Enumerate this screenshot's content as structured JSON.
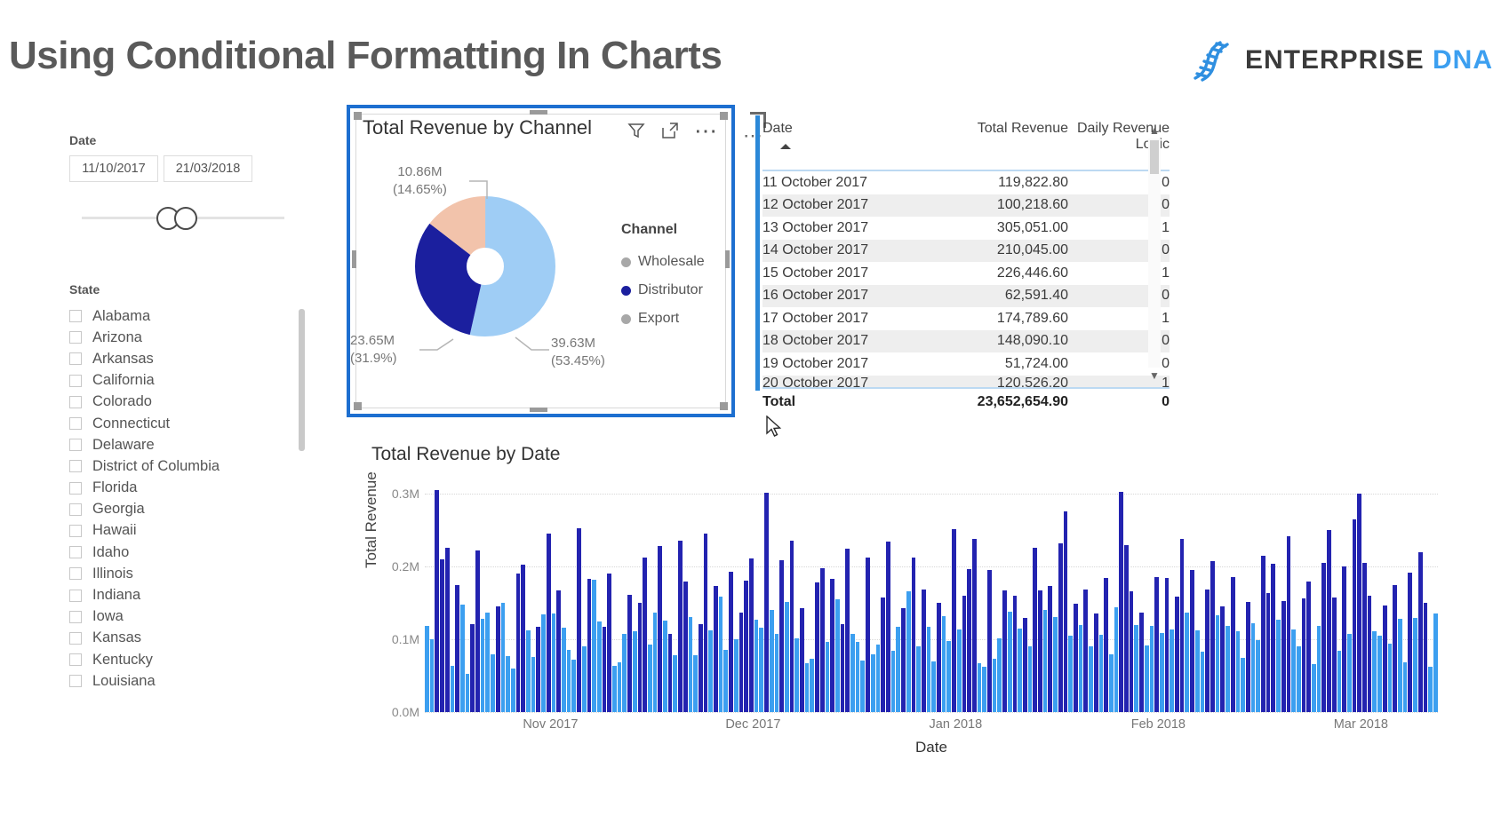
{
  "header": {
    "title": "Using Conditional Formatting In Charts",
    "brand_word1": "ENTERPRISE",
    "brand_word2": "DNA",
    "brand_icon": "dna-helix-icon"
  },
  "date_slicer": {
    "label": "Date",
    "start_value": "11/10/2017",
    "end_value": "21/03/2018"
  },
  "state_slicer": {
    "label": "State",
    "items": [
      "Alabama",
      "Arizona",
      "Arkansas",
      "California",
      "Colorado",
      "Connecticut",
      "Delaware",
      "District of Columbia",
      "Florida",
      "Georgia",
      "Hawaii",
      "Idaho",
      "Illinois",
      "Indiana",
      "Iowa",
      "Kansas",
      "Kentucky",
      "Louisiana"
    ]
  },
  "donut_visual": {
    "title": "Total Revenue by Channel",
    "icons": [
      "filter-icon",
      "focus-mode-icon",
      "more-options-icon"
    ],
    "legend_title": "Channel",
    "legend": [
      {
        "label": "Wholesale",
        "color": "#a8a8a8"
      },
      {
        "label": "Distributor",
        "color": "#1b1f9e"
      },
      {
        "label": "Export",
        "color": "#a8a8a8"
      }
    ],
    "labels": {
      "export_value": "10.86M",
      "export_pct": "(14.65%)",
      "distributor_value": "23.65M",
      "distributor_pct": "(31.9%)",
      "wholesale_value": "39.63M",
      "wholesale_pct": "(53.45%)"
    }
  },
  "table_visual": {
    "columns": [
      "Date",
      "Total Revenue",
      "Daily Revenue Logic"
    ],
    "sort_column": "Date",
    "sort_direction": "ascending",
    "rows": [
      {
        "date": "11 October 2017",
        "revenue": "119,822.80",
        "logic": "0"
      },
      {
        "date": "12 October 2017",
        "revenue": "100,218.60",
        "logic": "0"
      },
      {
        "date": "13 October 2017",
        "revenue": "305,051.00",
        "logic": "1"
      },
      {
        "date": "14 October 2017",
        "revenue": "210,045.00",
        "logic": "0"
      },
      {
        "date": "15 October 2017",
        "revenue": "226,446.60",
        "logic": "1"
      },
      {
        "date": "16 October 2017",
        "revenue": "62,591.40",
        "logic": "0"
      },
      {
        "date": "17 October 2017",
        "revenue": "174,789.60",
        "logic": "1"
      },
      {
        "date": "18 October 2017",
        "revenue": "148,090.10",
        "logic": "0"
      },
      {
        "date": "19 October 2017",
        "revenue": "51,724.00",
        "logic": "0"
      },
      {
        "date": "20 October 2017",
        "revenue": "120,526.20",
        "logic": "1"
      }
    ],
    "total_row": {
      "label": "Total",
      "revenue": "23,652,654.90",
      "logic": "0"
    }
  },
  "bar_visual": {
    "title": "Total Revenue by Date"
  },
  "chart_data": [
    {
      "type": "pie",
      "title": "Total Revenue by Channel",
      "legend_position": "right",
      "legend_title": "Channel",
      "slices": [
        {
          "name": "Wholesale",
          "value": 39.63,
          "unit": "M",
          "percent": 53.45,
          "color": "#9fcdf5"
        },
        {
          "name": "Distributor",
          "value": 23.65,
          "unit": "M",
          "percent": 31.9,
          "color": "#1b1f9e"
        },
        {
          "name": "Export",
          "value": 10.86,
          "unit": "M",
          "percent": 14.65,
          "color": "#f2c3ab"
        }
      ]
    },
    {
      "type": "bar",
      "title": "Total Revenue by Date",
      "xlabel": "Date",
      "ylabel": "Total Revenue",
      "ylim": [
        0,
        0.32
      ],
      "ytick_labels": [
        "0.0M",
        "0.1M",
        "0.2M",
        "0.3M"
      ],
      "ytick_values": [
        0,
        0.1,
        0.2,
        0.3
      ],
      "xtick_labels": [
        "Nov 2017",
        "Dec 2017",
        "Jan 2018",
        "Feb 2018",
        "Mar 2018"
      ],
      "grid": true,
      "color_rule": "dark navy when Daily Revenue Logic = 1, light blue when 0",
      "colors": {
        "high": "#2323b0",
        "low": "#3c9ff0"
      },
      "values": [
        0.118,
        0.1,
        0.305,
        0.21,
        0.226,
        0.063,
        0.175,
        0.148,
        0.052,
        0.121,
        0.222,
        0.128,
        0.137,
        0.08,
        0.145,
        0.15,
        0.077,
        0.06,
        0.19,
        0.203,
        0.112,
        0.076,
        0.117,
        0.134,
        0.246,
        0.136,
        0.167,
        0.116,
        0.086,
        0.072,
        0.253,
        0.09,
        0.183,
        0.182,
        0.124,
        0.117,
        0.191,
        0.064,
        0.068,
        0.107,
        0.161,
        0.111,
        0.15,
        0.213,
        0.093,
        0.137,
        0.229,
        0.126,
        0.108,
        0.078,
        0.236,
        0.18,
        0.131,
        0.078,
        0.121,
        0.245,
        0.112,
        0.174,
        0.159,
        0.086,
        0.193,
        0.1,
        0.137,
        0.181,
        0.211,
        0.127,
        0.116,
        0.302,
        0.141,
        0.108,
        0.209,
        0.151,
        0.236,
        0.101,
        0.143,
        0.067,
        0.073,
        0.178,
        0.198,
        0.096,
        0.183,
        0.155,
        0.121,
        0.225,
        0.108,
        0.097,
        0.071,
        0.213,
        0.079,
        0.093,
        0.158,
        0.234,
        0.084,
        0.117,
        0.143,
        0.166,
        0.213,
        0.09,
        0.168,
        0.117,
        0.07,
        0.15,
        0.132,
        0.098,
        0.252,
        0.114,
        0.16,
        0.197,
        0.238,
        0.067,
        0.062,
        0.195,
        0.073,
        0.101,
        0.167,
        0.138,
        0.16,
        0.115,
        0.13,
        0.091,
        0.226,
        0.167,
        0.14,
        0.174,
        0.131,
        0.232,
        0.276,
        0.105,
        0.149,
        0.12,
        0.168,
        0.09,
        0.136,
        0.106,
        0.184,
        0.079,
        0.144,
        0.303,
        0.23,
        0.166,
        0.12,
        0.137,
        0.092,
        0.118,
        0.186,
        0.109,
        0.185,
        0.113,
        0.159,
        0.238,
        0.137,
        0.195,
        0.112,
        0.083,
        0.169,
        0.208,
        0.133,
        0.145,
        0.119,
        0.186,
        0.111,
        0.074,
        0.151,
        0.122,
        0.099,
        0.215,
        0.164,
        0.204,
        0.127,
        0.153,
        0.242,
        0.113,
        0.09,
        0.156,
        0.179,
        0.066,
        0.118,
        0.205,
        0.25,
        0.158,
        0.084,
        0.2,
        0.107,
        0.265,
        0.301,
        0.205,
        0.16,
        0.111,
        0.105,
        0.146,
        0.094,
        0.175,
        0.128,
        0.068,
        0.192,
        0.129,
        0.22,
        0.15,
        0.062,
        0.135
      ],
      "logic": [
        0,
        0,
        1,
        1,
        1,
        0,
        1,
        0,
        0,
        1,
        1,
        0,
        0,
        0,
        1,
        0,
        0,
        0,
        1,
        1,
        0,
        0,
        1,
        0,
        1,
        0,
        1,
        0,
        0,
        0,
        1,
        0,
        1,
        0,
        0,
        1,
        1,
        0,
        0,
        0,
        1,
        0,
        1,
        1,
        0,
        0,
        1,
        0,
        1,
        0,
        1,
        1,
        0,
        0,
        1,
        1,
        0,
        1,
        0,
        0,
        1,
        0,
        1,
        1,
        1,
        0,
        0,
        1,
        0,
        0,
        1,
        0,
        1,
        0,
        1,
        0,
        0,
        1,
        1,
        0,
        1,
        0,
        1,
        1,
        0,
        0,
        0,
        1,
        0,
        0,
        1,
        1,
        0,
        0,
        1,
        0,
        1,
        0,
        1,
        0,
        0,
        1,
        0,
        0,
        1,
        0,
        1,
        1,
        1,
        0,
        0,
        1,
        0,
        0,
        1,
        0,
        1,
        0,
        1,
        0,
        1,
        1,
        0,
        1,
        0,
        1,
        1,
        0,
        1,
        0,
        1,
        0,
        1,
        0,
        1,
        0,
        0,
        1,
        1,
        1,
        0,
        1,
        0,
        0,
        1,
        0,
        1,
        0,
        1,
        1,
        0,
        1,
        0,
        0,
        1,
        1,
        0,
        1,
        0,
        1,
        0,
        0,
        1,
        0,
        0,
        1,
        1,
        1,
        0,
        1,
        1,
        0,
        0,
        1,
        1,
        0,
        0,
        1,
        1,
        1,
        0,
        1,
        0,
        1,
        1,
        1,
        1,
        0,
        0,
        1,
        0,
        1,
        0,
        0,
        1,
        0,
        1,
        1,
        0,
        0
      ]
    }
  ]
}
